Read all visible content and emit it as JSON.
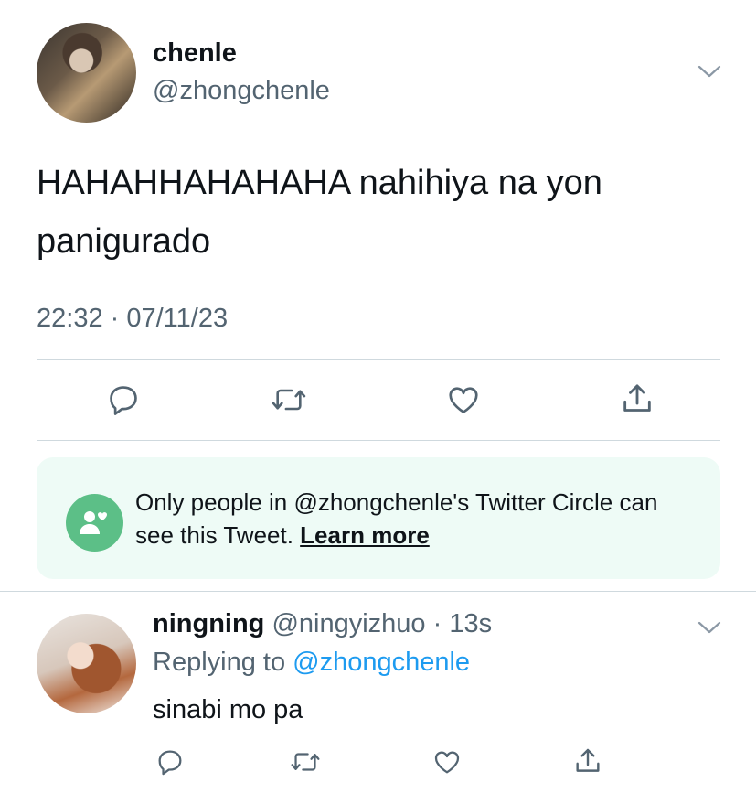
{
  "tweet": {
    "author_name": "chenle",
    "author_handle": "@zhongchenle",
    "text": "HAHAHHAHAHAHA nahihiya na yon panigurado",
    "timestamp": "22:32 · 07/11/23",
    "icons": [
      "reply-icon",
      "retweet-icon",
      "like-icon",
      "share-icon",
      "chevron-down-icon"
    ]
  },
  "circle_notice": {
    "text_part1": "Only people in ",
    "handle": "@zhongchenle's",
    "text_part2": " Twitter Circle can see this Tweet. ",
    "learn_more": "Learn more",
    "icon": "people-heart-icon",
    "icon_color": "#5cbf87"
  },
  "reply": {
    "author_name": "ningning",
    "author_handle": "@ningyizhuo",
    "separator": " · ",
    "age": "13s",
    "replying_label": "Replying to ",
    "replying_handle": "@zhongchenle",
    "text": "sinabi mo pa"
  },
  "colors": {
    "link": "#1d9bf0",
    "secondary_text": "#536471",
    "circle_background": "#eefbf6"
  }
}
